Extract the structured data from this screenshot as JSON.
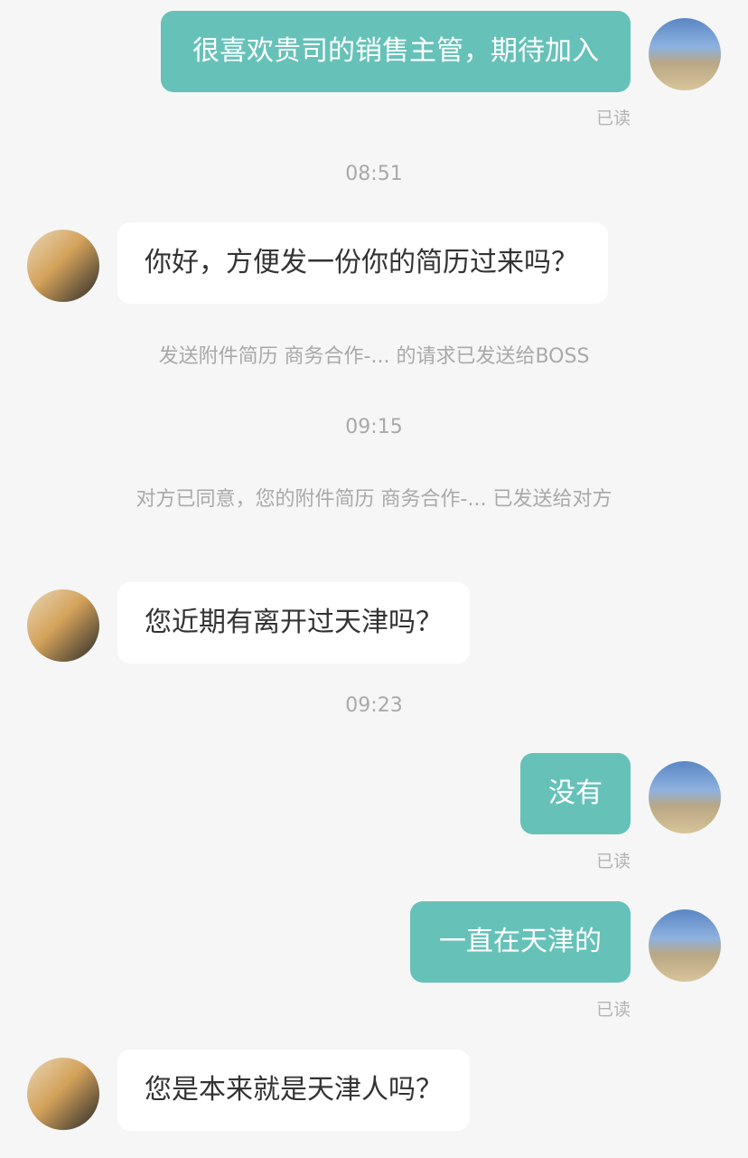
{
  "messages": {
    "m1": {
      "text": "很喜欢贵司的销售主管，期待加入",
      "status": "已读"
    },
    "t1": "08:51",
    "m2": {
      "text": "你好，方便发一份你的简历过来吗？"
    },
    "n1": "发送附件简历 商务合作-... 的请求已发送给BOSS",
    "t2": "09:15",
    "n2": "对方已同意，您的附件简历 商务合作-... 已发送给对方",
    "m3": {
      "text": "您近期有离开过天津吗？"
    },
    "t3": "09:23",
    "m4": {
      "text": "没有",
      "status": "已读"
    },
    "m5": {
      "text": "一直在天津的",
      "status": "已读"
    },
    "m6": {
      "text": "您是本来就是天津人吗？"
    }
  },
  "colors": {
    "self_bubble": "#66c2b8",
    "other_bubble": "#ffffff",
    "background": "#f6f6f6",
    "meta_text": "#a9a9a9"
  }
}
